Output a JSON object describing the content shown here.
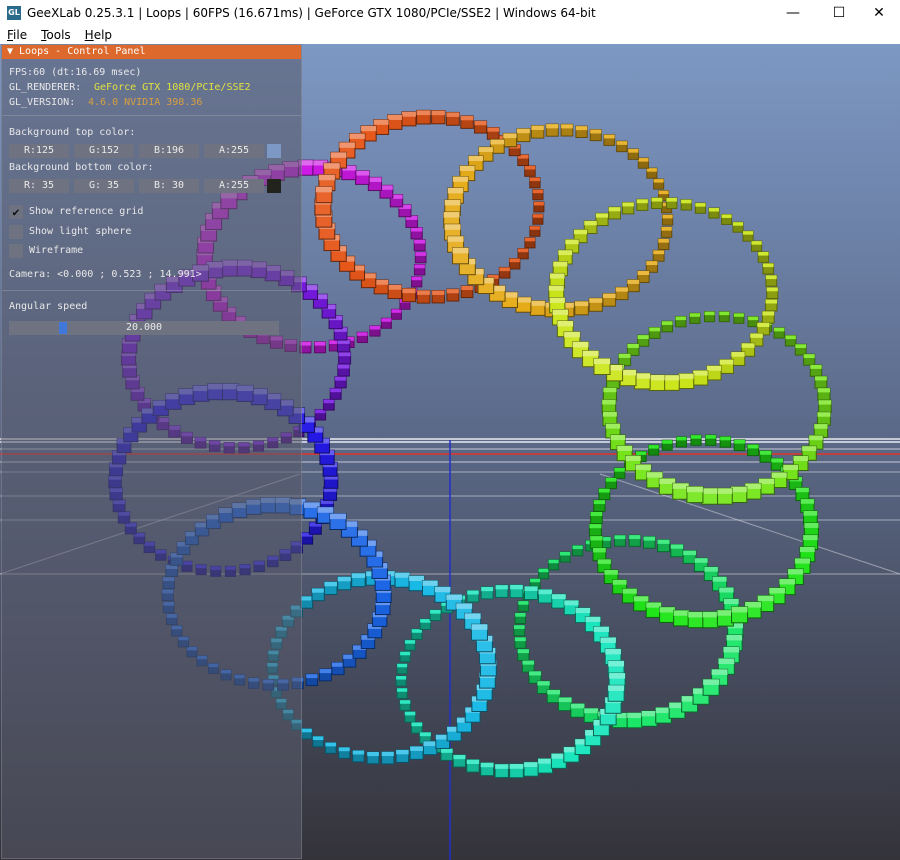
{
  "window": {
    "icon_text": "GL",
    "title": "GeeXLab 0.25.3.1 | Loops | 60FPS (16.671ms) | GeForce GTX 1080/PCIe/SSE2 | Windows 64-bit",
    "minimize": "—",
    "maximize": "☐",
    "close": "✕"
  },
  "menu": [
    {
      "key": "F",
      "rest": "ile"
    },
    {
      "key": "T",
      "rest": "ools"
    },
    {
      "key": "H",
      "rest": "elp"
    }
  ],
  "panel": {
    "header": "▼ Loops - Control Panel",
    "fps": "FPS:60 (dt:16.69 msec)",
    "renderer_label": "GL_RENDERER:",
    "renderer_value": "GeForce GTX 1080/PCIe/SSE2",
    "version_label": "GL_VERSION:",
    "version_value": "4.6.0 NVIDIA 398.36",
    "bg_top_label": "Background top color:",
    "bg_top": {
      "r": "R:125",
      "g": "G:152",
      "b": "B:196",
      "a": "A:255",
      "swatch": "#7d98c4"
    },
    "bg_bottom_label": "Background bottom color:",
    "bg_bottom": {
      "r": "R: 35",
      "g": "G: 35",
      "b": "B: 30",
      "a": "A:255",
      "swatch": "#23231e"
    },
    "checkboxes": [
      {
        "label": "Show reference grid",
        "checked": true
      },
      {
        "label": "Show light sphere",
        "checked": false
      },
      {
        "label": "Wireframe",
        "checked": false
      }
    ],
    "camera": "Camera: <0.000 ; 0.523 ; 14.991>",
    "angular_label": "Angular speed",
    "angular_value": "20.000",
    "angular_fraction": 0.2
  },
  "colors": {
    "panel_header": "#dd6a2c",
    "renderer_text": "#e0e040",
    "version_text": "#d8a040",
    "slider_knob": "#3f78d9",
    "bg_top": "#7d98c4",
    "bg_bottom": "#34333a"
  }
}
